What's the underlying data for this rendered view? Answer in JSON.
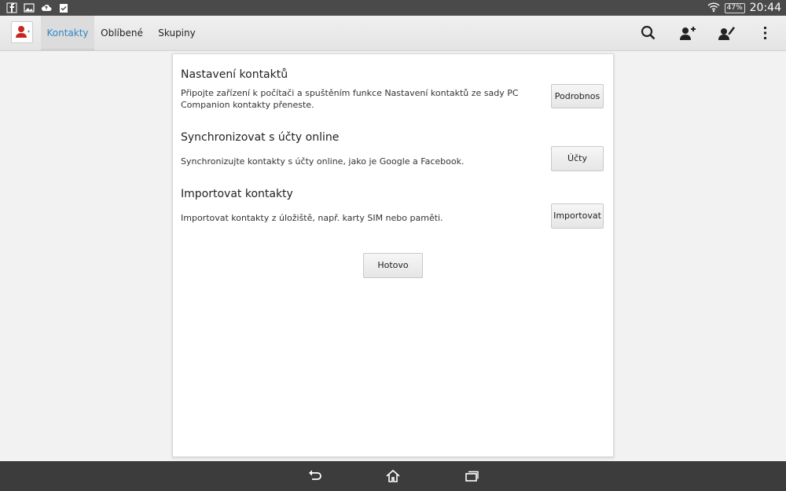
{
  "status_bar": {
    "icons": [
      "facebook-icon",
      "gallery-icon",
      "cloud-upload-icon",
      "task-check-icon"
    ],
    "battery": "47%",
    "time": "20:44"
  },
  "action_bar": {
    "tabs": [
      {
        "label": "Kontakty",
        "active": true
      },
      {
        "label": "Oblíbené",
        "active": false
      },
      {
        "label": "Skupiny",
        "active": false
      }
    ],
    "actions": [
      "search-icon",
      "add-contact-icon",
      "edit-contact-icon",
      "overflow-menu-icon"
    ]
  },
  "panel": {
    "sections": [
      {
        "title": "Nastavení kontaktů",
        "description": "Připojte zařízení k počítači a spuštěním funkce Nastavení kontaktů ze sady PC Companion kontakty přeneste.",
        "button": "Podrobnos"
      },
      {
        "title": "Synchronizovat s účty online",
        "description": "Synchronizujte kontakty s účty online, jako je Google a Facebook.",
        "button": "Účty"
      },
      {
        "title": "Importovat kontakty",
        "description": "Importovat kontakty z úložiště, např. karty SIM nebo paměti.",
        "button": "Importovat"
      }
    ],
    "done_button": "Hotovo"
  },
  "nav_bar": [
    "back-icon",
    "home-icon",
    "recent-apps-icon"
  ]
}
